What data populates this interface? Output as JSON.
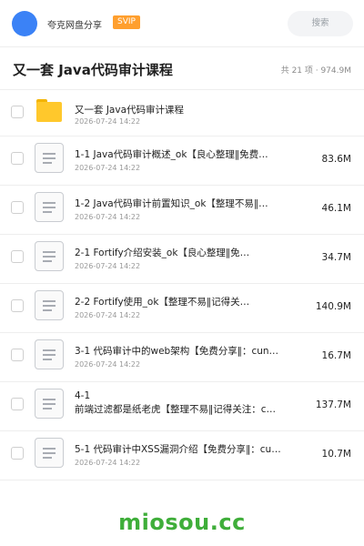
{
  "header": {
    "app_name": "夸克网盘分享",
    "badge": "SVIP",
    "search_label": "搜索",
    "avatar_color": "#3b82f6"
  },
  "folder": {
    "title": "又一套 Java代码审计课程",
    "summary": "共 21 项 · 974.9M"
  },
  "files": [
    {
      "type": "folder",
      "name": "又一套 Java代码审计课程",
      "date": "2026-07-24 14:22",
      "size": ""
    },
    {
      "type": "file",
      "name": "1-1 Java代码审计概述_ok【良心整理‖免费…",
      "date": "2026-07-24 14:22",
      "size": "83.6M"
    },
    {
      "type": "file",
      "name": "1-2 Java代码审计前置知识_ok【整理不易‖…",
      "date": "2026-07-24 14:22",
      "size": "46.1M"
    },
    {
      "type": "file",
      "name": "2-1 Fortify介绍安装_ok【良心整理‖免…",
      "date": "2026-07-24 14:22",
      "size": "34.7M"
    },
    {
      "type": "file",
      "name": "2-2 Fortify使用_ok【整理不易‖记得关…",
      "date": "2026-07-24 14:22",
      "size": "140.9M"
    },
    {
      "type": "file",
      "name": "3-1 代码审计中的web架构【免费分享‖：cun…",
      "date": "2026-07-24 14:22",
      "size": "16.7M"
    },
    {
      "type": "file",
      "name": "4-1",
      "name2": "前端过滤都是纸老虎【整理不易‖记得关注：c…",
      "date": "2026-07-24 14:22",
      "size": "137.7M"
    },
    {
      "type": "file",
      "name": "5-1 代码审计中XSS漏洞介绍【免费分享‖：cu…",
      "date": "2026-07-24 14:22",
      "size": "10.7M"
    }
  ],
  "watermark": "miosou.cc"
}
